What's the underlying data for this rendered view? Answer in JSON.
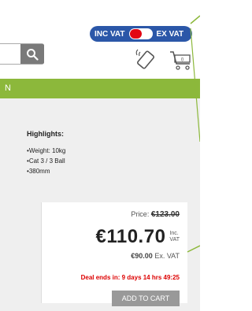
{
  "header": {
    "vat_toggle": {
      "inc_label": "INC VAT",
      "ex_label": "EX VAT"
    },
    "icons": {
      "search": "search-icon",
      "phone": "phone-icon",
      "cart": "cart-icon"
    }
  },
  "nav": {
    "text": "N"
  },
  "highlights": {
    "title": "Highlights:",
    "items": [
      "Weight: 10kg",
      "Cat 3 / 3 Ball",
      "380mm"
    ]
  },
  "pricing": {
    "old_label": "Price:",
    "old_price": "€123.00",
    "price_inc": "€110.70",
    "inc_tag_line1": "Inc.",
    "inc_tag_line2": "VAT",
    "price_ex": "€90.00",
    "ex_tag": "Ex. VAT",
    "deal_text": "Deal ends in: 9 days 14 hrs 49:25",
    "add_to_cart": "ADD TO CART"
  },
  "colors": {
    "brand_blue": "#2b57a8",
    "nav_green": "#8cb83b",
    "toggle_red": "#e30613",
    "deal_red": "#dd0000"
  }
}
